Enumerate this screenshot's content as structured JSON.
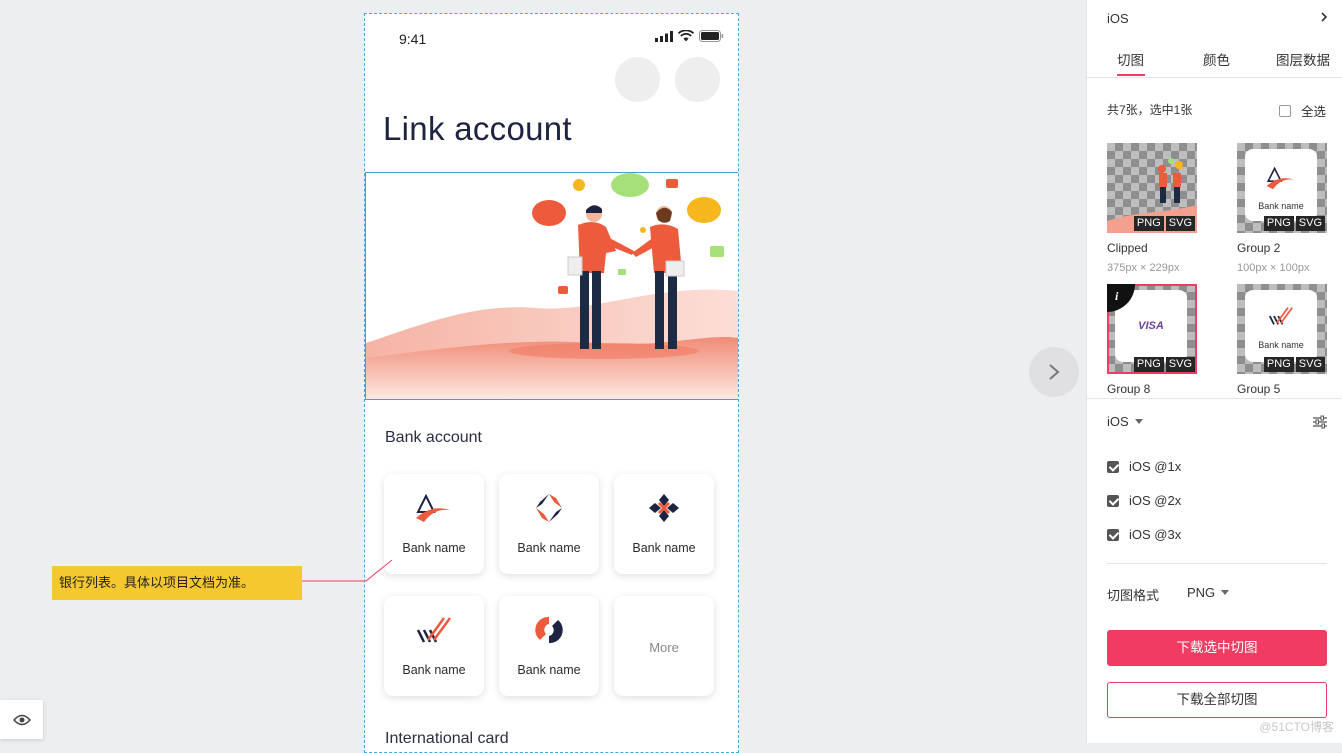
{
  "phone": {
    "status_time": "9:41",
    "title": "Link account",
    "bank_section_title": "Bank account",
    "banks": [
      {
        "name": "Bank name"
      },
      {
        "name": "Bank name"
      },
      {
        "name": "Bank name"
      },
      {
        "name": "Bank name"
      },
      {
        "name": "Bank name"
      }
    ],
    "more_label": "More",
    "intl_section_title": "International card"
  },
  "annotation": {
    "text": "银行列表。具体以项目文档为准。"
  },
  "panel": {
    "platform": "iOS",
    "tabs": [
      "切图",
      "颜色",
      "图层数据"
    ],
    "active_tab": "切图",
    "count_text": "共7张，选中1张",
    "select_all_label": "全选",
    "assets": [
      {
        "name": "Clipped",
        "size": "375px × 229px",
        "formats": [
          "PNG",
          "SVG"
        ]
      },
      {
        "name": "Group 2",
        "size": "100px × 100px",
        "formats": [
          "PNG",
          "SVG"
        ],
        "preview_text": "Bank name"
      },
      {
        "name": "Group 8",
        "formats": [
          "PNG",
          "SVG"
        ],
        "preview_text": "VISA",
        "selected": true
      },
      {
        "name": "Group 5",
        "formats": [
          "PNG",
          "SVG"
        ],
        "preview_text": "Bank name"
      }
    ],
    "export_platform": "iOS",
    "scales": [
      {
        "label": "iOS @1x",
        "checked": true
      },
      {
        "label": "iOS @2x",
        "checked": true
      },
      {
        "label": "iOS @3x",
        "checked": true
      }
    ],
    "format_label": "切图格式",
    "format_value": "PNG",
    "download_selected": "下载选中切图",
    "download_all": "下载全部切图",
    "watermark": "@51CTO博客"
  },
  "colors": {
    "accent": "#f03c63",
    "brand_coral": "#ef5a3c",
    "navy": "#1d2340"
  }
}
